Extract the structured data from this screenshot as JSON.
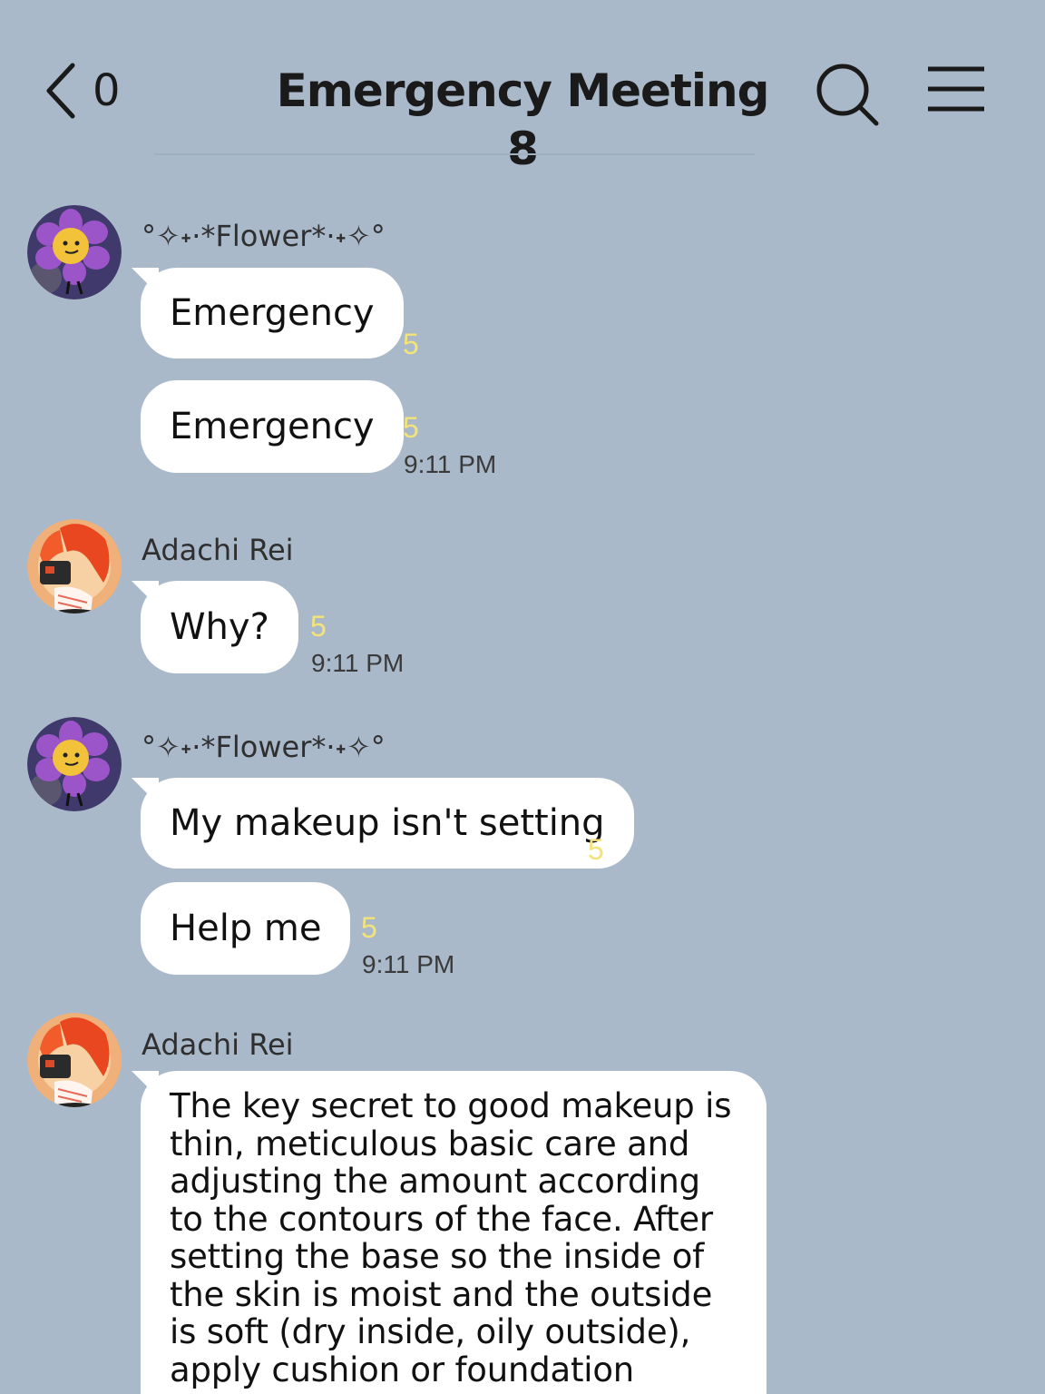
{
  "header": {
    "back_count": "0",
    "title": "Emergency Meeting 8"
  },
  "colors": {
    "background": "#a9b9ca",
    "bubble": "#ffffff",
    "read_count": "#f2e37a"
  },
  "icons": [
    "chevron-left-icon",
    "search-icon",
    "menu-icon"
  ],
  "messages": [
    {
      "sender": "°✧˖·*Flower*·˖✧°",
      "avatar": "flower-avatar",
      "bubbles": [
        {
          "text": "Emergency",
          "read": "5"
        },
        {
          "text": "Emergency",
          "read": "5",
          "time": "9:11 PM"
        }
      ]
    },
    {
      "sender": "Adachi Rei",
      "avatar": "adachi-rei-avatar",
      "bubbles": [
        {
          "text": "Why?",
          "read": "5",
          "time": "9:11 PM"
        }
      ]
    },
    {
      "sender": "°✧˖·*Flower*·˖✧°",
      "avatar": "flower-avatar",
      "bubbles": [
        {
          "text": "My makeup isn't setting",
          "read": "5"
        },
        {
          "text": "Help me",
          "read": "5",
          "time": "9:11 PM"
        }
      ]
    },
    {
      "sender": "Adachi Rei",
      "avatar": "adachi-rei-avatar",
      "bubbles": [
        {
          "text": "The key secret to good makeup is thin, meticulous basic care and adjusting the amount according to the contours of the face. After setting the base so the inside of the skin is moist and the outside is soft (dry inside, oily outside), apply cushion or foundation"
        }
      ]
    }
  ]
}
